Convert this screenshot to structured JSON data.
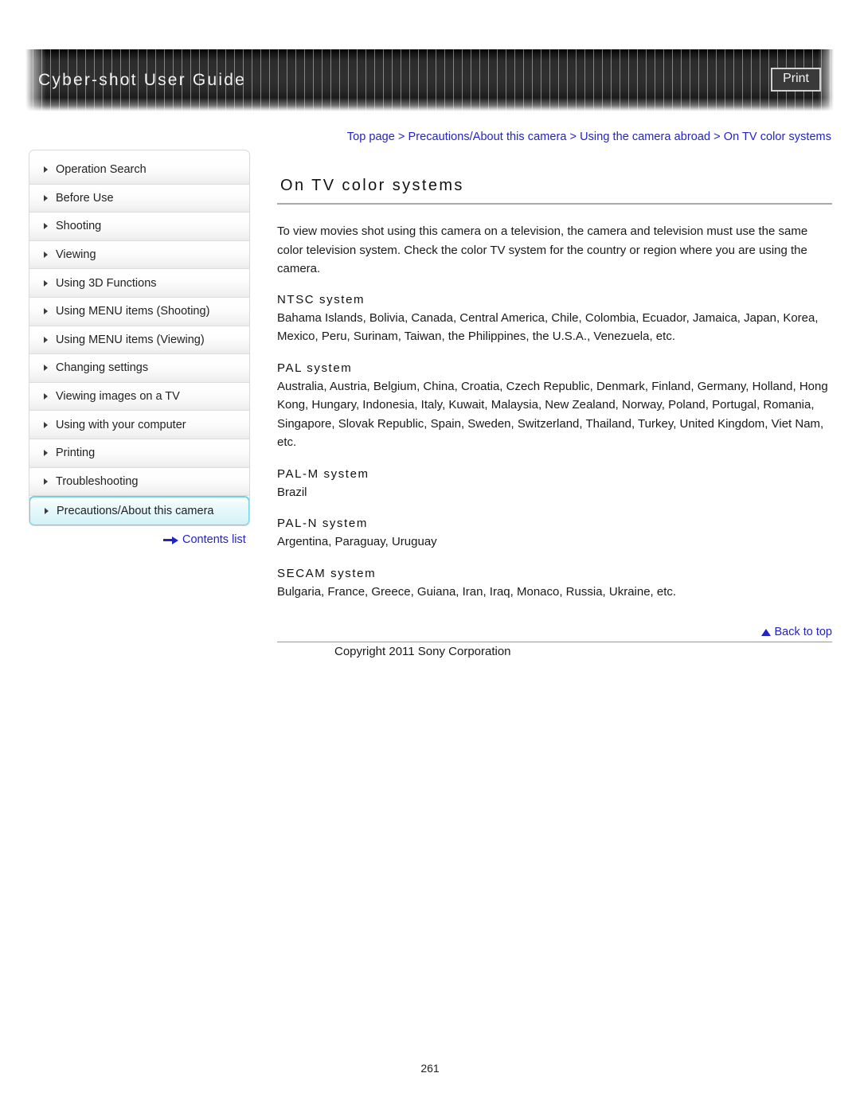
{
  "header": {
    "title": "Cyber-shot User Guide",
    "print_label": "Print"
  },
  "breadcrumb": {
    "full": "Top page > Precautions/About this camera > Using the camera abroad > On TV color systems",
    "items": [
      "Top page",
      "Precautions/About this camera",
      "Using the camera abroad",
      "On TV color systems"
    ],
    "separator": ">"
  },
  "sidebar": {
    "items": [
      {
        "label": "Operation Search",
        "active": false
      },
      {
        "label": "Before Use",
        "active": false
      },
      {
        "label": "Shooting",
        "active": false
      },
      {
        "label": "Viewing",
        "active": false
      },
      {
        "label": "Using 3D Functions",
        "active": false
      },
      {
        "label": "Using MENU items (Shooting)",
        "active": false
      },
      {
        "label": "Using MENU items (Viewing)",
        "active": false
      },
      {
        "label": "Changing settings",
        "active": false
      },
      {
        "label": "Viewing images on a TV",
        "active": false
      },
      {
        "label": "Using with your computer",
        "active": false
      },
      {
        "label": "Printing",
        "active": false
      },
      {
        "label": "Troubleshooting",
        "active": false
      },
      {
        "label": "Precautions/About this camera",
        "active": true
      }
    ],
    "contents_link": "Contents list"
  },
  "main": {
    "heading": "On TV color systems",
    "intro": "To view movies shot using this camera on a television, the camera and television must use the same color television system. Check the color TV system for the country or region where you are using the camera.",
    "sections": [
      {
        "heading": "NTSC system",
        "body": "Bahama Islands, Bolivia, Canada, Central America, Chile, Colombia, Ecuador, Jamaica, Japan, Korea, Mexico, Peru, Surinam, Taiwan, the Philippines, the U.S.A., Venezuela, etc."
      },
      {
        "heading": "PAL system",
        "body": "Australia, Austria, Belgium, China, Croatia, Czech Republic, Denmark, Finland, Germany, Holland, Hong Kong, Hungary, Indonesia, Italy, Kuwait, Malaysia, New Zealand, Norway, Poland, Portugal, Romania, Singapore, Slovak Republic, Spain, Sweden, Switzerland, Thailand, Turkey, United Kingdom, Viet Nam, etc."
      },
      {
        "heading": "PAL-M system",
        "body": "Brazil"
      },
      {
        "heading": "PAL-N system",
        "body": "Argentina, Paraguay, Uruguay"
      },
      {
        "heading": "SECAM system",
        "body": "Bulgaria, France, Greece, Guiana, Iran, Iraq, Monaco, Russia, Ukraine, etc."
      }
    ]
  },
  "footer": {
    "back_to_top": "Back to top",
    "copyright": "Copyright 2011 Sony Corporation",
    "page_number": "261"
  },
  "colors": {
    "link": "#2323c8",
    "banner_dark": "#2b2b2b",
    "active_border": "#6fd4e2",
    "active_bg": "#dcf5f9",
    "rule": "#aaaaaa"
  }
}
